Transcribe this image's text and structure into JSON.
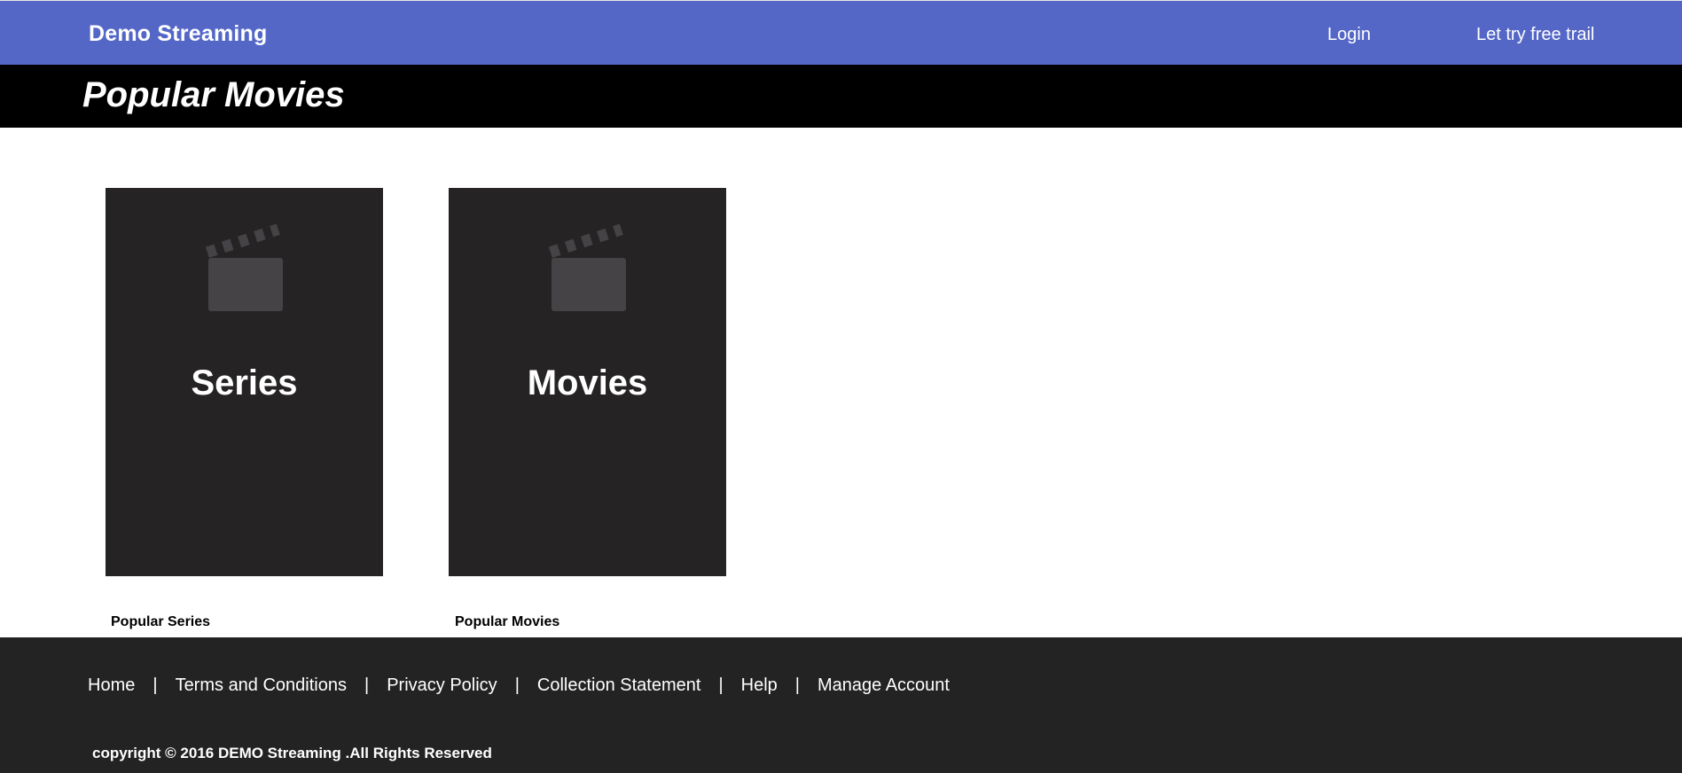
{
  "header": {
    "brand": "Demo Streaming",
    "nav": {
      "login": "Login",
      "free_trial": "Let try free trail"
    }
  },
  "title_bar": {
    "title": "Popular Movies"
  },
  "cards": [
    {
      "label": "Series",
      "caption": "Popular Series",
      "icon": "clapperboard-icon"
    },
    {
      "label": "Movies",
      "caption": "Popular Movies",
      "icon": "clapperboard-icon"
    }
  ],
  "footer": {
    "links": [
      "Home",
      "Terms and Conditions",
      "Privacy Policy",
      "Collection Statement",
      "Help",
      "Manage Account"
    ],
    "separator": "|",
    "copyright": "copyright © 2016 DEMO Streaming .All Rights Reserved"
  },
  "colors": {
    "header_bg": "#5467c7",
    "title_bg": "#000000",
    "card_bg": "#252324",
    "footer_bg": "#232323"
  }
}
